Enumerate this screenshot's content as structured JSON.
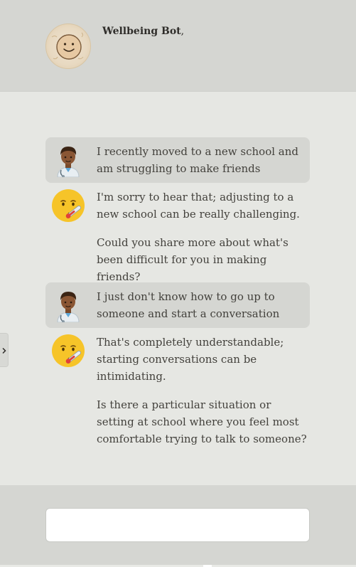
{
  "header": {
    "bot_name": "Wellbeing Bot",
    "bot_name_suffix": ","
  },
  "messages": [
    {
      "role": "user",
      "icon": "health-worker-emoji-icon",
      "paragraphs": [
        "I recently moved to a new school and am struggling to make friends"
      ]
    },
    {
      "role": "bot",
      "icon": "face-with-thermometer-emoji-icon",
      "paragraphs": [
        "I'm sorry to hear that; adjusting to a new school can be really challenging.",
        "Could you share more about what's been difficult for you in making friends?"
      ]
    },
    {
      "role": "user",
      "icon": "health-worker-emoji-icon",
      "paragraphs": [
        "I just don't know how to go up to someone and start a conversation"
      ]
    },
    {
      "role": "bot",
      "icon": "face-with-thermometer-emoji-icon",
      "paragraphs": [
        "That's completely understandable; starting conversations can be intimidating.",
        "Is there a particular situation or setting at school where you feel most comfortable trying to talk to someone?"
      ]
    }
  ],
  "composer": {
    "value": "",
    "placeholder": ""
  },
  "colors": {
    "page_background": "#e6e7e3",
    "header_background": "#d5d6d2",
    "user_bubble": "#d5d6d2",
    "input_background": "#ffffff"
  }
}
